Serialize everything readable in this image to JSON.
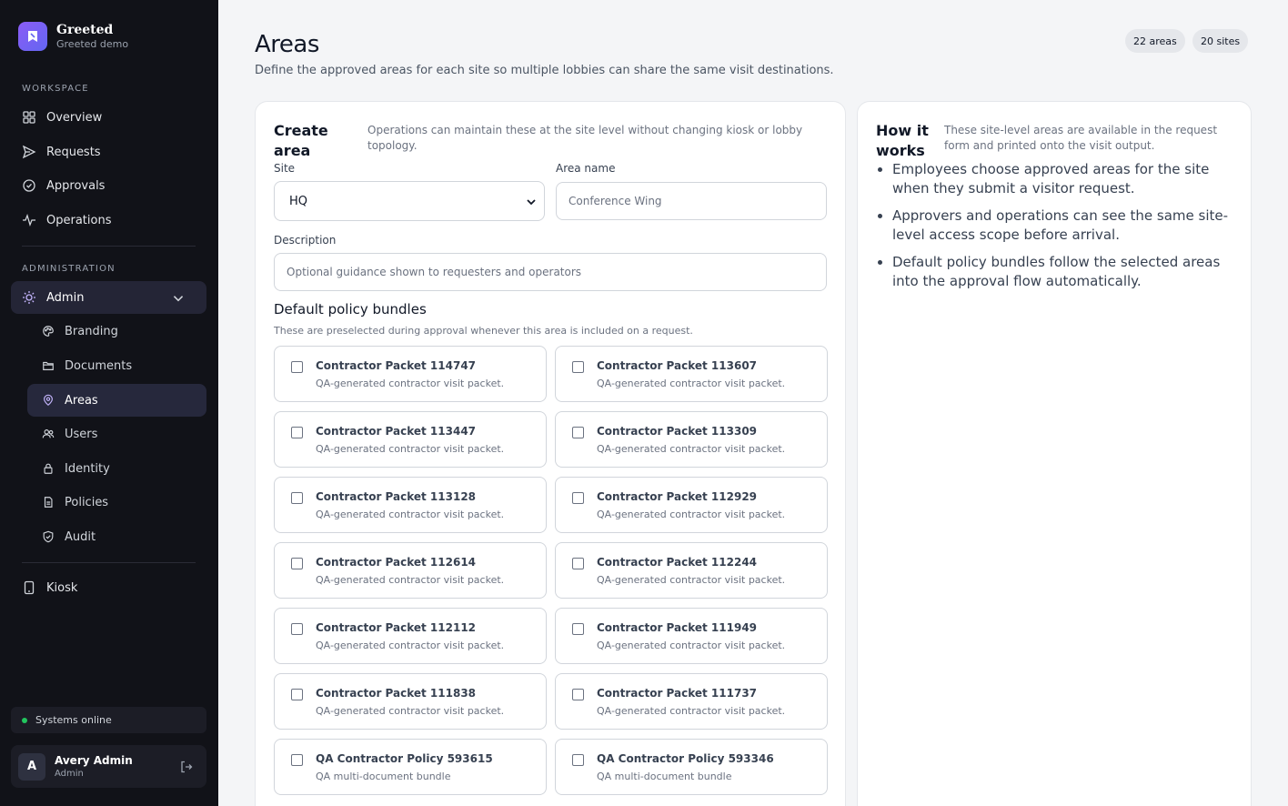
{
  "brand": {
    "name": "Greeted",
    "sub": "Greeted demo"
  },
  "sidebar": {
    "workspace_label": "WORKSPACE",
    "workspace_items": [
      {
        "label": "Overview",
        "icon": "grid-icon"
      },
      {
        "label": "Requests",
        "icon": "send-icon"
      },
      {
        "label": "Approvals",
        "icon": "check-circle-icon"
      },
      {
        "label": "Operations",
        "icon": "activity-icon"
      }
    ],
    "admin_label": "ADMINISTRATION",
    "admin_parent": {
      "label": "Admin",
      "icon": "sun-icon"
    },
    "admin_items": [
      {
        "label": "Branding",
        "icon": "palette-icon"
      },
      {
        "label": "Documents",
        "icon": "folder-icon"
      },
      {
        "label": "Areas",
        "icon": "map-pin-icon"
      },
      {
        "label": "Users",
        "icon": "users-icon"
      },
      {
        "label": "Identity",
        "icon": "lock-icon"
      },
      {
        "label": "Policies",
        "icon": "file-icon"
      },
      {
        "label": "Audit",
        "icon": "shield-check-icon"
      }
    ],
    "kiosk": {
      "label": "Kiosk",
      "icon": "tablet-icon"
    },
    "status": "Systems online",
    "user": {
      "initial": "A",
      "name": "Avery Admin",
      "role": "Admin"
    }
  },
  "header": {
    "title": "Areas",
    "subtitle": "Define the approved areas for each site so multiple lobbies can share the same visit destinations.",
    "badges": [
      "22 areas",
      "20 sites"
    ]
  },
  "create": {
    "title_line1": "Create",
    "title_line2": "area",
    "desc": "Operations can maintain these at the site level without changing kiosk or lobby topology.",
    "site_label": "Site",
    "site_value": "HQ",
    "area_label": "Area name",
    "area_placeholder": "Conference Wing",
    "desc_label": "Description",
    "desc_placeholder": "Optional guidance shown to requesters and operators",
    "bundles_title": "Default policy bundles",
    "bundles_desc": "These are preselected during approval whenever this area is included on a request.",
    "bundles": [
      {
        "name": "Contractor Packet 114747",
        "desc": "QA-generated contractor visit packet."
      },
      {
        "name": "Contractor Packet 113607",
        "desc": "QA-generated contractor visit packet."
      },
      {
        "name": "Contractor Packet 113447",
        "desc": "QA-generated contractor visit packet."
      },
      {
        "name": "Contractor Packet 113309",
        "desc": "QA-generated contractor visit packet."
      },
      {
        "name": "Contractor Packet 113128",
        "desc": "QA-generated contractor visit packet."
      },
      {
        "name": "Contractor Packet 112929",
        "desc": "QA-generated contractor visit packet."
      },
      {
        "name": "Contractor Packet 112614",
        "desc": "QA-generated contractor visit packet."
      },
      {
        "name": "Contractor Packet 112244",
        "desc": "QA-generated contractor visit packet."
      },
      {
        "name": "Contractor Packet 112112",
        "desc": "QA-generated contractor visit packet."
      },
      {
        "name": "Contractor Packet 111949",
        "desc": "QA-generated contractor visit packet."
      },
      {
        "name": "Contractor Packet 111838",
        "desc": "QA-generated contractor visit packet."
      },
      {
        "name": "Contractor Packet 111737",
        "desc": "QA-generated contractor visit packet."
      },
      {
        "name": "QA Contractor Policy 593615",
        "desc": "QA multi-document bundle"
      },
      {
        "name": "QA Contractor Policy 593346",
        "desc": "QA multi-document bundle"
      }
    ]
  },
  "how": {
    "title_line1": "How it",
    "title_line2": "works",
    "desc": "These site-level areas are available in the request form and printed onto the visit output.",
    "points": [
      "Employees choose approved areas for the site when they submit a visitor request.",
      "Approvers and operations can see the same site-level access scope before arrival.",
      "Default policy bundles follow the selected areas into the approval flow automatically."
    ]
  }
}
